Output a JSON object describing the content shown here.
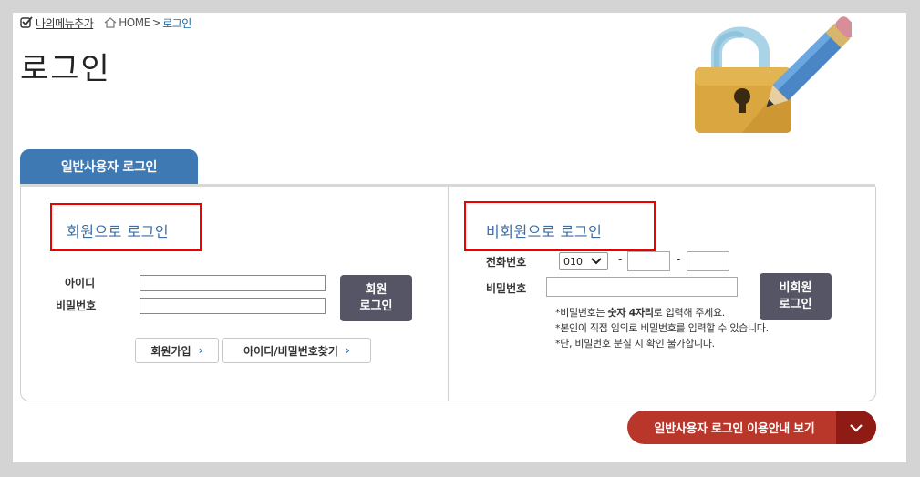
{
  "topbar": {
    "my_menu_label": "나의메뉴추가",
    "breadcrumb_home": "HOME",
    "breadcrumb_sep": ">",
    "breadcrumb_current": "로그인"
  },
  "page": {
    "title": "로그인"
  },
  "tabs": {
    "general_user": "일반사용자 로그인"
  },
  "member": {
    "title": "회원으로 로그인",
    "id_label": "아이디",
    "pw_label": "비밀번호",
    "id_value": "",
    "pw_value": "",
    "login_button_line1": "회원",
    "login_button_line2": "로그인",
    "signup_label": "회원가입",
    "find_label": "아이디/비밀번호찾기"
  },
  "nonmember": {
    "title": "비회원으로 로그인",
    "phone_label": "전화번호",
    "phone_prefix_selected": "010",
    "phone_dash": "-",
    "pw_label": "비밀번호",
    "login_button_line1": "비회원",
    "login_button_line2": "로그인",
    "note1_prefix": "비밀번호는 ",
    "note1_bold": "숫자 4자리",
    "note1_suffix": "로 입력해 주세요.",
    "note2": "본인이 직접 임의로 비밀번호를 입력할 수 있습니다.",
    "note3": "단, 비밀번호 분실 시 확인 불가합니다.",
    "note_mark": "*"
  },
  "guide": {
    "label": "일반사용자 로그인 이용안내 보기"
  },
  "colors": {
    "tab": "#3f79b4",
    "section_title": "#3a6ea8",
    "highlight": "#ee0000",
    "dark_button": "#555565",
    "guide_button": "#b8372a",
    "guide_arrow": "#8e1c14"
  },
  "icons": [
    "checkmark-icon",
    "home-icon",
    "chevron-right-icon",
    "chevron-down-icon",
    "lock-pencil-illustration"
  ]
}
